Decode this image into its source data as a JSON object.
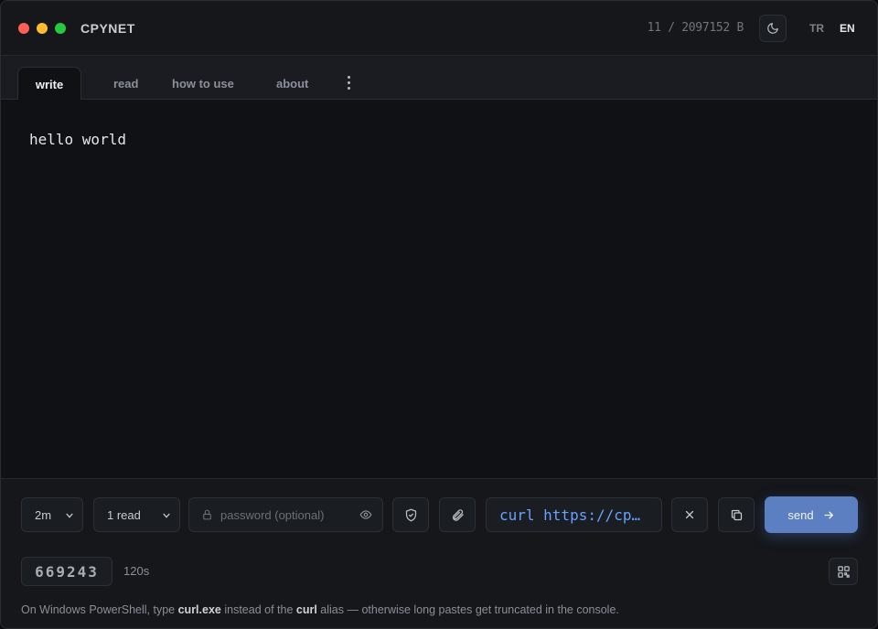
{
  "window": {
    "title": "CPYNET",
    "byte_counter": "11 / 2097152 B",
    "languages": [
      "TR",
      "EN"
    ],
    "active_language": "EN"
  },
  "tabs": [
    {
      "label": "write",
      "active": true
    },
    {
      "label": "read",
      "active": false
    },
    {
      "label": "how to use",
      "active": false
    },
    {
      "label": "about",
      "active": false
    }
  ],
  "editor": {
    "content": "hello world"
  },
  "controls": {
    "expiry": {
      "selected": "2m"
    },
    "reads": {
      "selected": "1 read"
    },
    "password": {
      "placeholder": "password (optional)",
      "value": ""
    },
    "curl_command": "curl https://cp…",
    "send_label": "send"
  },
  "result": {
    "code": "669243",
    "ttl": "120s"
  },
  "hint": {
    "part1": "On Windows PowerShell, type ",
    "bold1": "curl.exe",
    "part2": " instead of the ",
    "bold2": "curl",
    "part3": " alias — otherwise long pastes get truncated in the console."
  },
  "colors": {
    "accent": "#5b7fc0",
    "link": "#6aa0ff",
    "background": "#15171b"
  },
  "icons": [
    "moon-icon",
    "kebab-menu-icon",
    "chevron-down-icon",
    "lock-icon",
    "eye-icon",
    "shield-icon",
    "paperclip-icon",
    "close-icon",
    "copy-icon",
    "arrow-right-icon",
    "qr-code-icon"
  ]
}
